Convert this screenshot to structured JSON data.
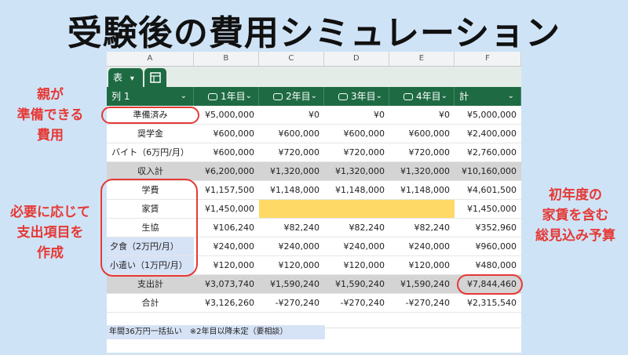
{
  "title": "受験後の費用シミュレーション",
  "columns": [
    "A",
    "B",
    "C",
    "D",
    "E",
    "F"
  ],
  "tab_label": "表",
  "header": {
    "col1": "列 1",
    "years": [
      "1年目",
      "2年目",
      "3年目",
      "4年目"
    ],
    "total": "計"
  },
  "rows": [
    {
      "label": "準備済み",
      "values": [
        "¥5,000,000",
        "¥0",
        "¥0",
        "¥0",
        "¥5,000,000"
      ]
    },
    {
      "label": "奨学金",
      "values": [
        "¥600,000",
        "¥600,000",
        "¥600,000",
        "¥600,000",
        "¥2,400,000"
      ]
    },
    {
      "label": "バイト（6万円/月）",
      "values": [
        "¥600,000",
        "¥720,000",
        "¥720,000",
        "¥720,000",
        "¥2,760,000"
      ]
    },
    {
      "label": "収入計",
      "values": [
        "¥6,200,000",
        "¥1,320,000",
        "¥1,320,000",
        "¥1,320,000",
        "¥10,160,000"
      ]
    },
    {
      "label": "学費",
      "values": [
        "¥1,157,500",
        "¥1,148,000",
        "¥1,148,000",
        "¥1,148,000",
        "¥4,601,500"
      ]
    },
    {
      "label": "家賃",
      "values": [
        "¥1,450,000",
        "",
        "",
        "",
        "¥1,450,000"
      ]
    },
    {
      "label": "生協",
      "values": [
        "¥106,240",
        "¥82,240",
        "¥82,240",
        "¥82,240",
        "¥352,960"
      ]
    },
    {
      "label": "夕食（2万円/月）",
      "values": [
        "¥240,000",
        "¥240,000",
        "¥240,000",
        "¥240,000",
        "¥960,000"
      ]
    },
    {
      "label": "小遣い（1万円/月）",
      "values": [
        "¥120,000",
        "¥120,000",
        "¥120,000",
        "¥120,000",
        "¥480,000"
      ]
    },
    {
      "label": "支出計",
      "values": [
        "¥3,073,740",
        "¥1,590,240",
        "¥1,590,240",
        "¥1,590,240",
        "¥7,844,460"
      ]
    },
    {
      "label": "合計",
      "values": [
        "¥3,126,260",
        "-¥270,240",
        "-¥270,240",
        "-¥270,240",
        "¥2,315,540"
      ]
    }
  ],
  "footnote": "年間36万円一括払い　※2年目以降未定（要相談）",
  "annotations": {
    "parents": "親が\n準備できる\n費用",
    "as_needed": "必要に応じて\n支出項目を\n作成",
    "budget": "初年度の\n家賃を含む\n総見込み予算"
  },
  "colors": {
    "header_green": "#1e6b43",
    "highlight_yellow": "#ffd966",
    "label_blue": "#d6e2f6",
    "annotation_red": "#e53935",
    "background": "#cfe3f6"
  }
}
